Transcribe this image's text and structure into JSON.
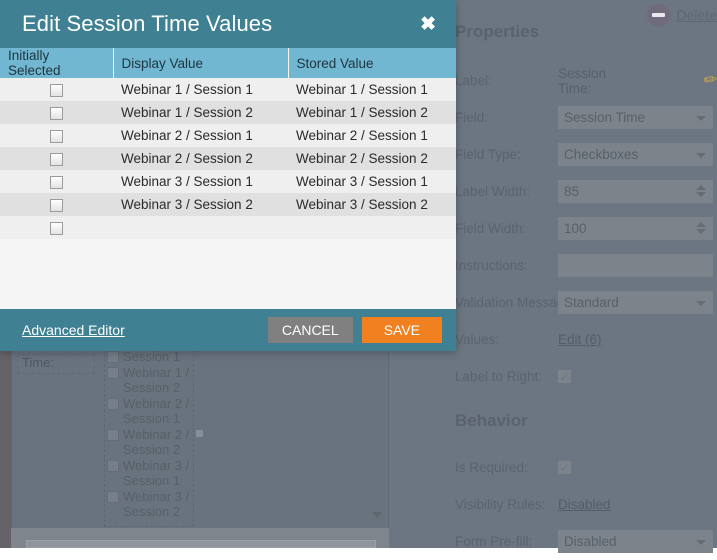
{
  "colors": {
    "dialog_header": "#3f8092",
    "table_header": "#72b7d1",
    "save_button": "#f08020",
    "cancel_button": "#808080",
    "page_overlay": "#6b7682"
  },
  "page": {
    "delete_link": "Delete",
    "delete_icon": "delete-circle-icon"
  },
  "properties": {
    "section_title": "Properties",
    "behavior_title": "Behavior",
    "rows": [
      {
        "label": "Label:",
        "value": "Session Time:",
        "kind": "text-with-pencil"
      },
      {
        "label": "Field:",
        "value": "Session Time",
        "kind": "select"
      },
      {
        "label": "Field Type:",
        "value": "Checkboxes",
        "kind": "select"
      },
      {
        "label": "Label Width:",
        "value": "85",
        "kind": "spinner"
      },
      {
        "label": "Field Width:",
        "value": "100",
        "kind": "spinner"
      },
      {
        "label": "Instructions:",
        "value": "",
        "kind": "field"
      },
      {
        "label": "Validation Message:",
        "value": "Standard",
        "kind": "select"
      },
      {
        "label": "Values:",
        "value": "Edit (6)",
        "kind": "link"
      },
      {
        "label": "Label to Right:",
        "value": "✓",
        "kind": "check"
      }
    ],
    "behavior_rows": [
      {
        "label": "Is Required:",
        "value": "✓",
        "kind": "check"
      },
      {
        "label": "Visibility Rules:",
        "value": "Disabled",
        "kind": "link"
      },
      {
        "label": "Form Pre-fill:",
        "value": "Disabled",
        "kind": "select"
      }
    ]
  },
  "form_preview": {
    "field_label": "Time:",
    "options": [
      "Session 1",
      "Webinar 1 / Session 2",
      "Webinar 2 / Session 1",
      "Webinar 2 / Session 2",
      "Webinar 3 / Session 1",
      "Webinar 3 / Session 2"
    ]
  },
  "modal": {
    "title": "Edit Session Time Values",
    "close_icon": "close-icon",
    "columns": [
      "Initially Selected",
      "Display Value",
      "Stored Value"
    ],
    "rows": [
      {
        "selected": false,
        "display": "Webinar 1 / Session 1",
        "stored": "Webinar 1 / Session 1"
      },
      {
        "selected": false,
        "display": "Webinar 1 / Session 2",
        "stored": "Webinar 1 / Session 2"
      },
      {
        "selected": false,
        "display": "Webinar 2 / Session 1",
        "stored": "Webinar 2 / Session 1"
      },
      {
        "selected": false,
        "display": "Webinar 2 / Session 2",
        "stored": "Webinar 2 / Session 2"
      },
      {
        "selected": false,
        "display": "Webinar 3 / Session 1",
        "stored": "Webinar 3 / Session 1"
      },
      {
        "selected": false,
        "display": "Webinar 3 / Session 2",
        "stored": "Webinar 3 / Session 2"
      },
      {
        "selected": false,
        "display": "",
        "stored": ""
      }
    ],
    "footer": {
      "advanced_editor": "Advanced Editor",
      "cancel": "CANCEL",
      "save": "SAVE"
    }
  }
}
